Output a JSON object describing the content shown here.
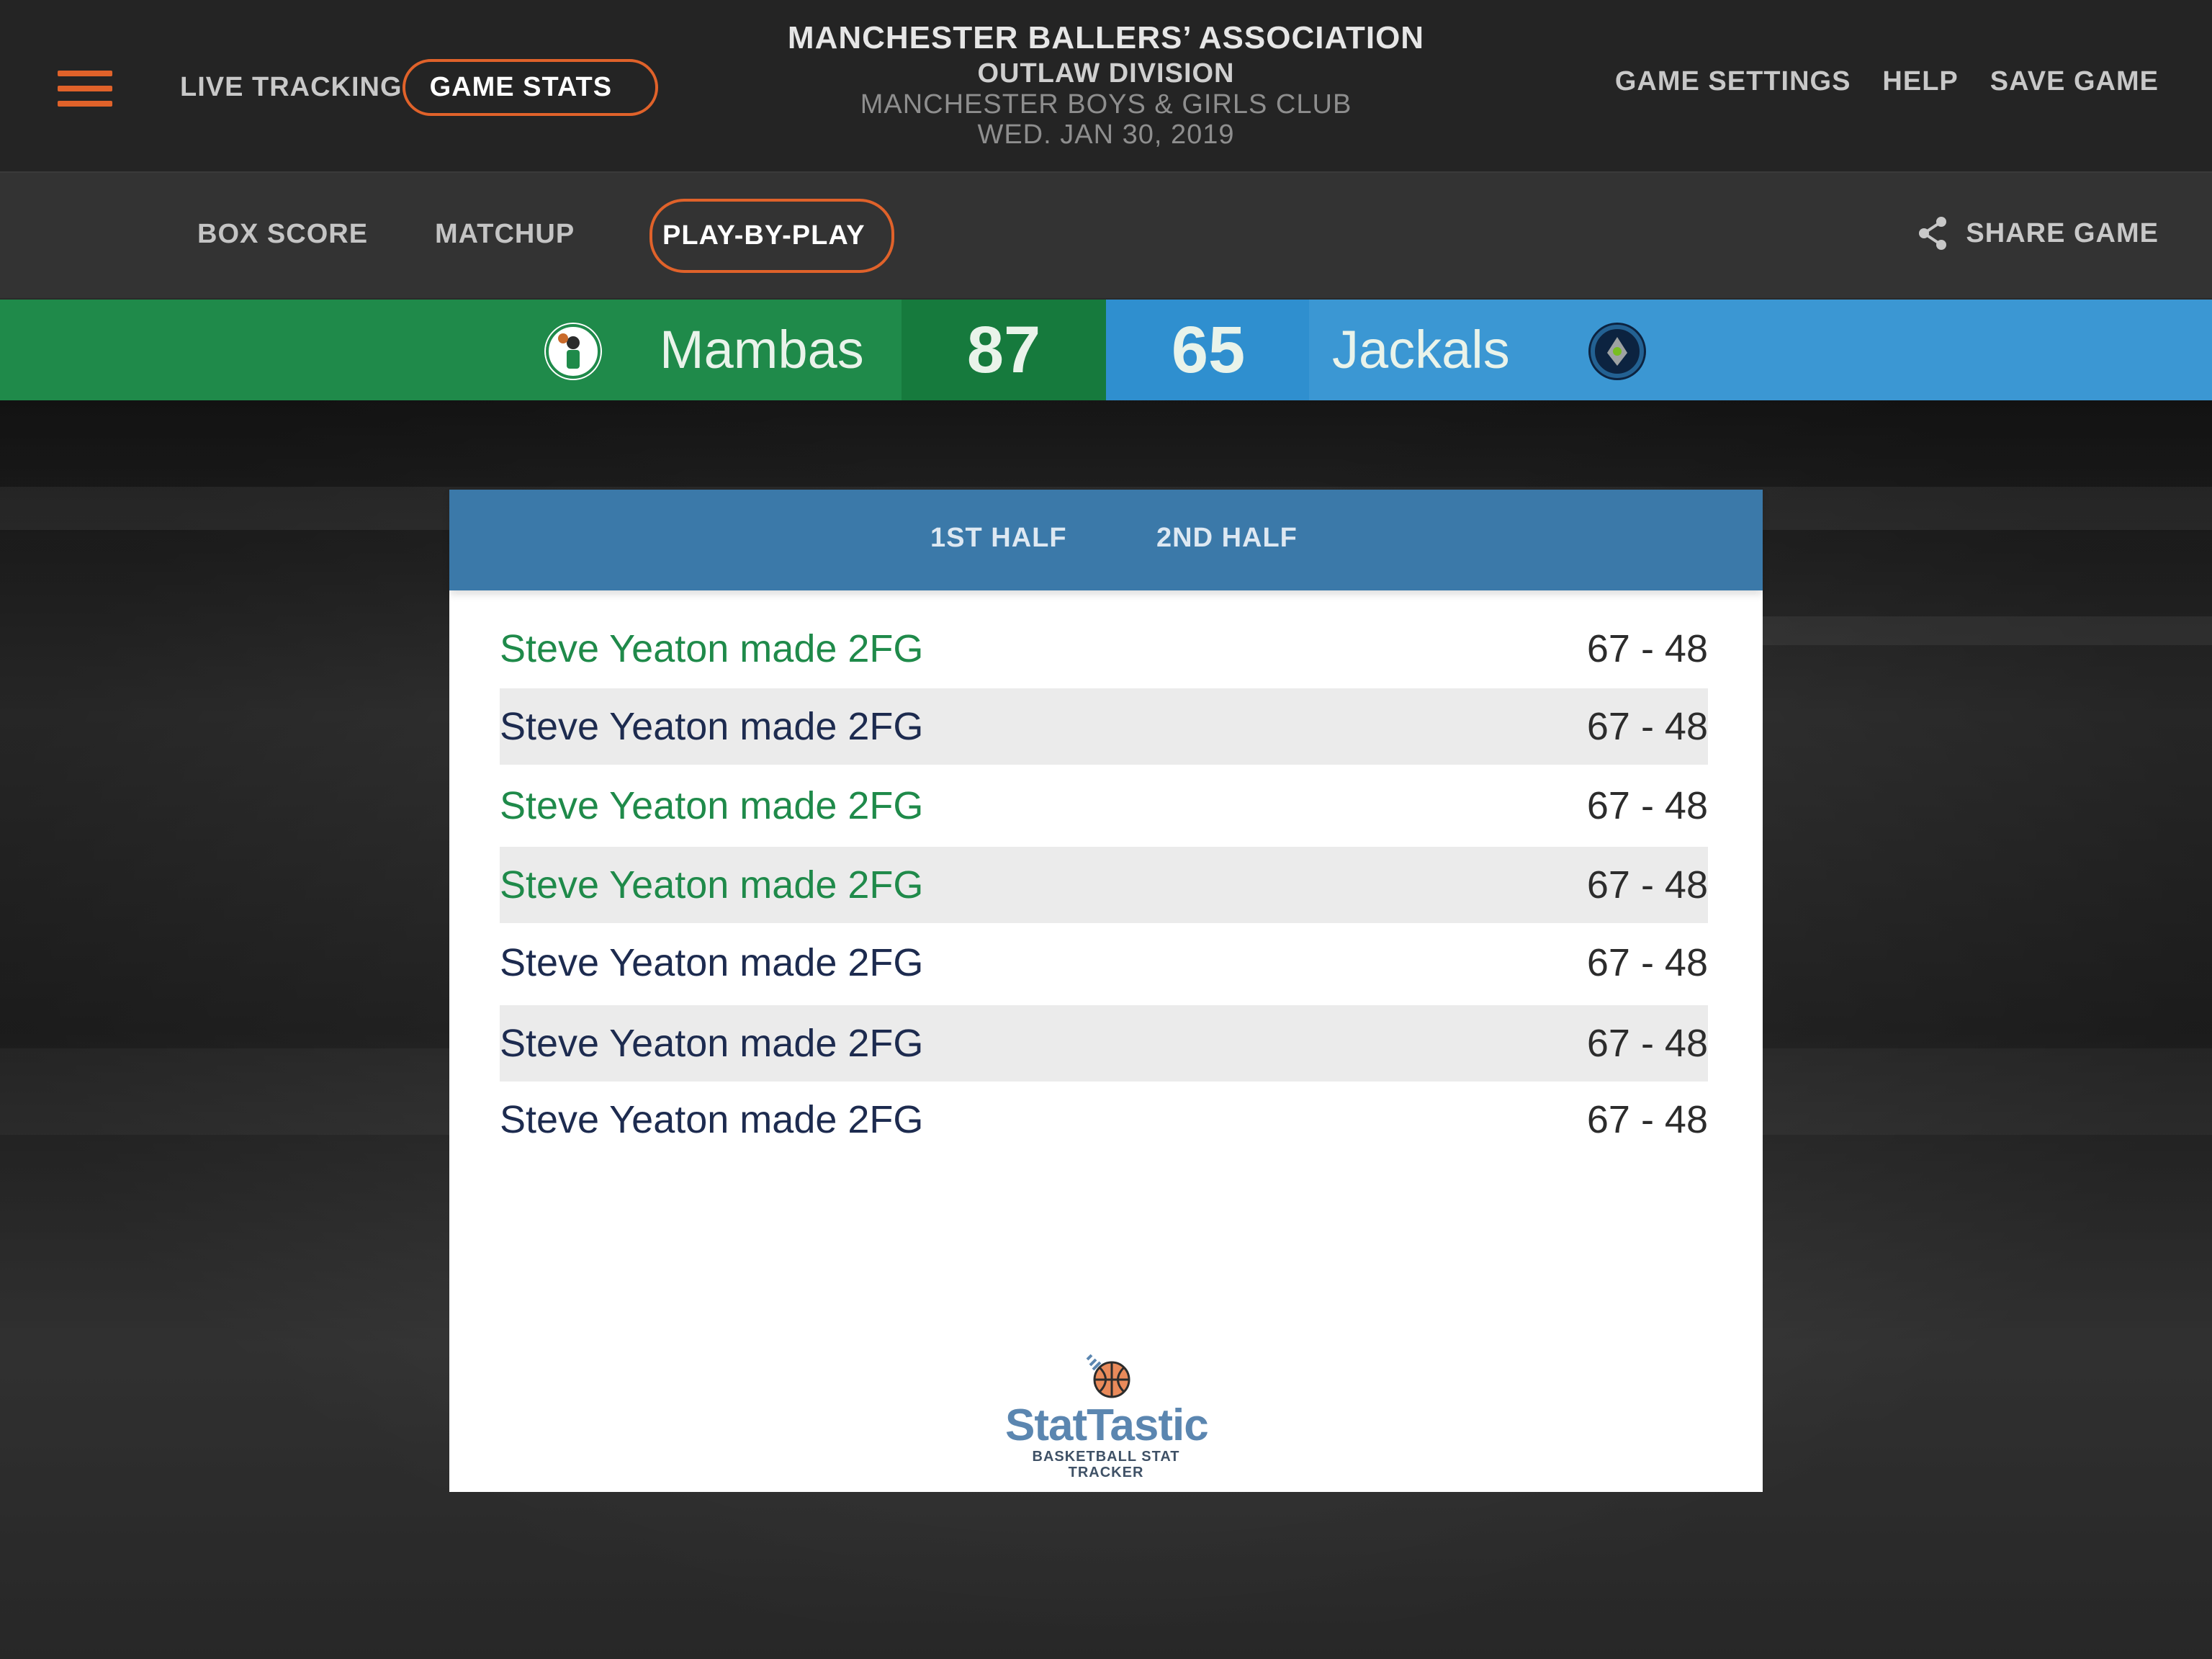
{
  "header": {
    "title": "MANCHESTER BALLERS’ ASSOCIATION",
    "division": "OUTLAW DIVISION",
    "venue": "MANCHESTER BOYS & GIRLS CLUB",
    "date": "WED. JAN 30, 2019"
  },
  "nav_left": {
    "live_tracking": "LIVE TRACKING",
    "game_stats": "GAME STATS"
  },
  "nav_right": {
    "game_settings": "GAME SETTINGS",
    "help": "HELP",
    "save_game": "SAVE GAME"
  },
  "subtabs": {
    "box_score": "BOX SCORE",
    "matchup": "MATCHUP",
    "play_by_play": "PLAY-BY-PLAY",
    "share": "SHARE GAME"
  },
  "scoreboard": {
    "home": {
      "name": "Mambas",
      "score": "87",
      "color": "#1f8a4a"
    },
    "away": {
      "name": "Jackals",
      "score": "65",
      "color": "#3b97d3"
    }
  },
  "halves": {
    "first": "1ST HALF",
    "second": "2ND HALF"
  },
  "plays": [
    {
      "desc": "Steve Yeaton made 2FG",
      "score": "67 - 48",
      "team": "home"
    },
    {
      "desc": "Steve Yeaton made 2FG",
      "score": "67 - 48",
      "team": "away"
    },
    {
      "desc": "Steve Yeaton made 2FG",
      "score": "67 - 48",
      "team": "home"
    },
    {
      "desc": "Steve Yeaton made 2FG",
      "score": "67 - 48",
      "team": "home"
    },
    {
      "desc": "Steve Yeaton made 2FG",
      "score": "67 - 48",
      "team": "away"
    },
    {
      "desc": "Steve Yeaton made 2FG",
      "score": "67 - 48",
      "team": "away"
    },
    {
      "desc": "Steve Yeaton made 2FG",
      "score": "67 - 48",
      "team": "away"
    }
  ],
  "brand": {
    "name": "StatTastic",
    "tagline": "BASKETBALL STAT TRACKER"
  },
  "colors": {
    "accent": "#e0622a",
    "home_text": "#1f8a4a",
    "away_text": "#1d2b4f",
    "panel_header": "#3b79a9"
  },
  "icons": {
    "menu": "hamburger-menu-icon",
    "share": "share-icon",
    "home_logo": "team-logo-home",
    "away_logo": "team-logo-away",
    "brand": "basketball-icon"
  }
}
